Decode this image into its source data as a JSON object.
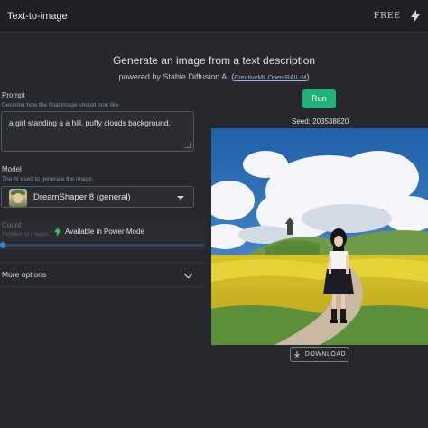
{
  "app": {
    "title": "Text-to-image",
    "plan_badge": "FREE"
  },
  "header": {
    "headline": "Generate an image from a text description",
    "powered_by": "powered by Stable Diffusion AI (",
    "license": "CreativeML Open RAIL-M",
    "close_paren": ")"
  },
  "prompt": {
    "label": "Prompt",
    "description": "Describe how the final image should look like",
    "value": "a girl standing a a hill, puffy clouds background,"
  },
  "model": {
    "label": "Model",
    "description": "The AI used to generate the image.",
    "selected": "DreamShaper 8 (general)"
  },
  "count": {
    "label": "Count",
    "description": "Number of images",
    "value": 1,
    "locked_text": "Available in Power Mode"
  },
  "more_options": {
    "label": "More options"
  },
  "run": {
    "label": "Run"
  },
  "seed": {
    "label": "Seed: 203538820"
  },
  "download": {
    "label": "DOWNLOAD"
  },
  "colors": {
    "accent_run": "#21b27a",
    "power_bolt": "#2ecc71",
    "background": "#26282e"
  },
  "icons": [
    "bolt-icon",
    "chevron-down-icon",
    "caret-down-icon",
    "download-icon",
    "model-avatar",
    "resize-handle-icon"
  ]
}
